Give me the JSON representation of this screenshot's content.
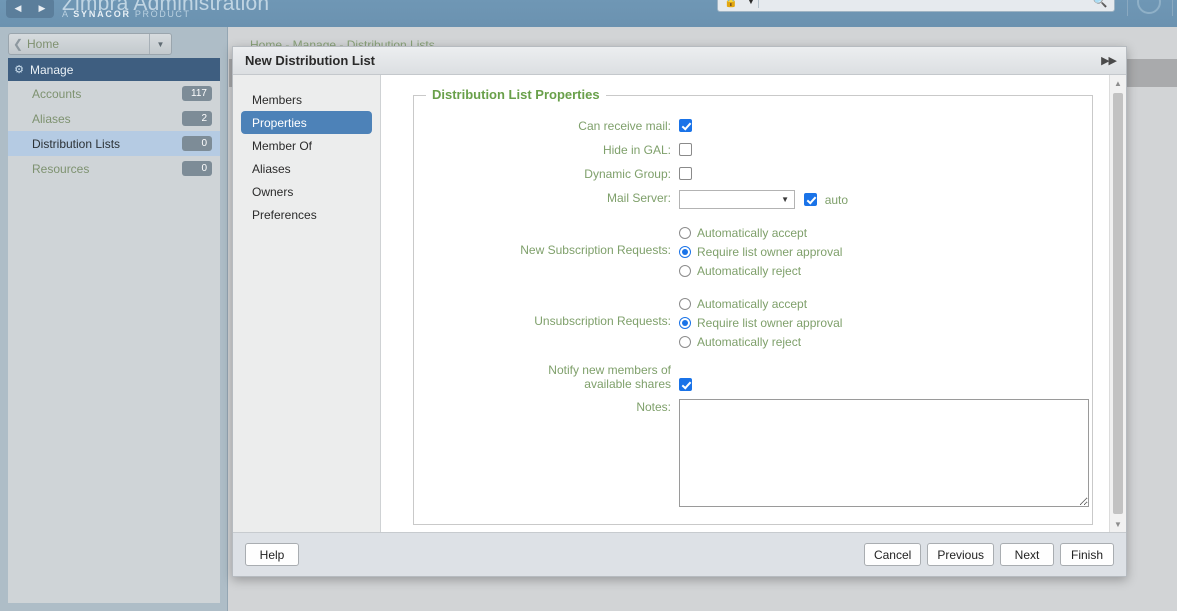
{
  "topbar": {
    "brand": "Zimbra Administration",
    "brand_sub_pre": "A ",
    "brand_sub_bold": "SYNACOR",
    "brand_sub_post": " PRODUCT",
    "back_icon": "back-arrow-icon",
    "forward_icon": "forward-arrow-icon",
    "search": {
      "value": "",
      "placeholder": "",
      "type_icon": "search-scope-icon",
      "caret_icon": "chevron-down-icon",
      "go_icon": "magnifier-icon"
    },
    "user_icon": "user-avatar-icon"
  },
  "sidebar": {
    "home": {
      "label": "Home",
      "back_icon": "chevron-left-icon",
      "caret_icon": "chevron-down-icon"
    },
    "section": {
      "label": "Manage",
      "icon": "manage-gear-icon"
    },
    "items": [
      {
        "label": "Accounts",
        "count": "117",
        "selected": false
      },
      {
        "label": "Aliases",
        "count": "2",
        "selected": false
      },
      {
        "label": "Distribution Lists",
        "count": "0",
        "selected": true
      },
      {
        "label": "Resources",
        "count": "0",
        "selected": false
      }
    ]
  },
  "main": {
    "breadcrumb": "Home - Manage - Distribution Lists"
  },
  "dialog": {
    "title": "New Distribution List",
    "expand_icon": "double-chevron-right-icon",
    "tabs": [
      {
        "label": "Members",
        "active": false
      },
      {
        "label": "Properties",
        "active": true
      },
      {
        "label": "Member Of",
        "active": false
      },
      {
        "label": "Aliases",
        "active": false
      },
      {
        "label": "Owners",
        "active": false
      },
      {
        "label": "Preferences",
        "active": false
      }
    ],
    "scrollbar": {
      "up_icon": "scroll-up-arrow-icon",
      "down_icon": "scroll-down-arrow-icon"
    },
    "fieldset": {
      "legend": "Distribution List Properties",
      "can_receive_mail": {
        "label": "Can receive mail:",
        "checked": true
      },
      "hide_in_gal": {
        "label": "Hide in GAL:",
        "checked": false
      },
      "dynamic_group": {
        "label": "Dynamic Group:",
        "checked": false
      },
      "mail_server": {
        "label": "Mail Server:",
        "value": "",
        "caret_icon": "chevron-down-icon",
        "auto_label": "auto",
        "auto_checked": true
      },
      "new_subscription": {
        "label": "New Subscription Requests:",
        "options": [
          {
            "label": "Automatically accept",
            "selected": false
          },
          {
            "label": "Require list owner approval",
            "selected": true
          },
          {
            "label": "Automatically reject",
            "selected": false
          }
        ]
      },
      "unsubscription": {
        "label": "Unsubscription Requests:",
        "options": [
          {
            "label": "Automatically accept",
            "selected": false
          },
          {
            "label": "Require list owner approval",
            "selected": true
          },
          {
            "label": "Automatically reject",
            "selected": false
          }
        ]
      },
      "notify_new_members": {
        "label_line1": "Notify new members of",
        "label_line2": "available shares",
        "checked": true
      },
      "notes": {
        "label": "Notes:",
        "value": ""
      }
    },
    "footer": {
      "help": "Help",
      "cancel": "Cancel",
      "previous": "Previous",
      "next": "Next",
      "finish": "Finish"
    }
  },
  "colors": {
    "accent_blue": "#4d82b8",
    "checkbox_blue": "#1a73e8",
    "label_green": "#7fa06b",
    "legend_green": "#69a04a",
    "topbar_blue": "#6f97b5",
    "manage_blue": "#3e5e80",
    "selected_row": "#b5cbe3"
  }
}
